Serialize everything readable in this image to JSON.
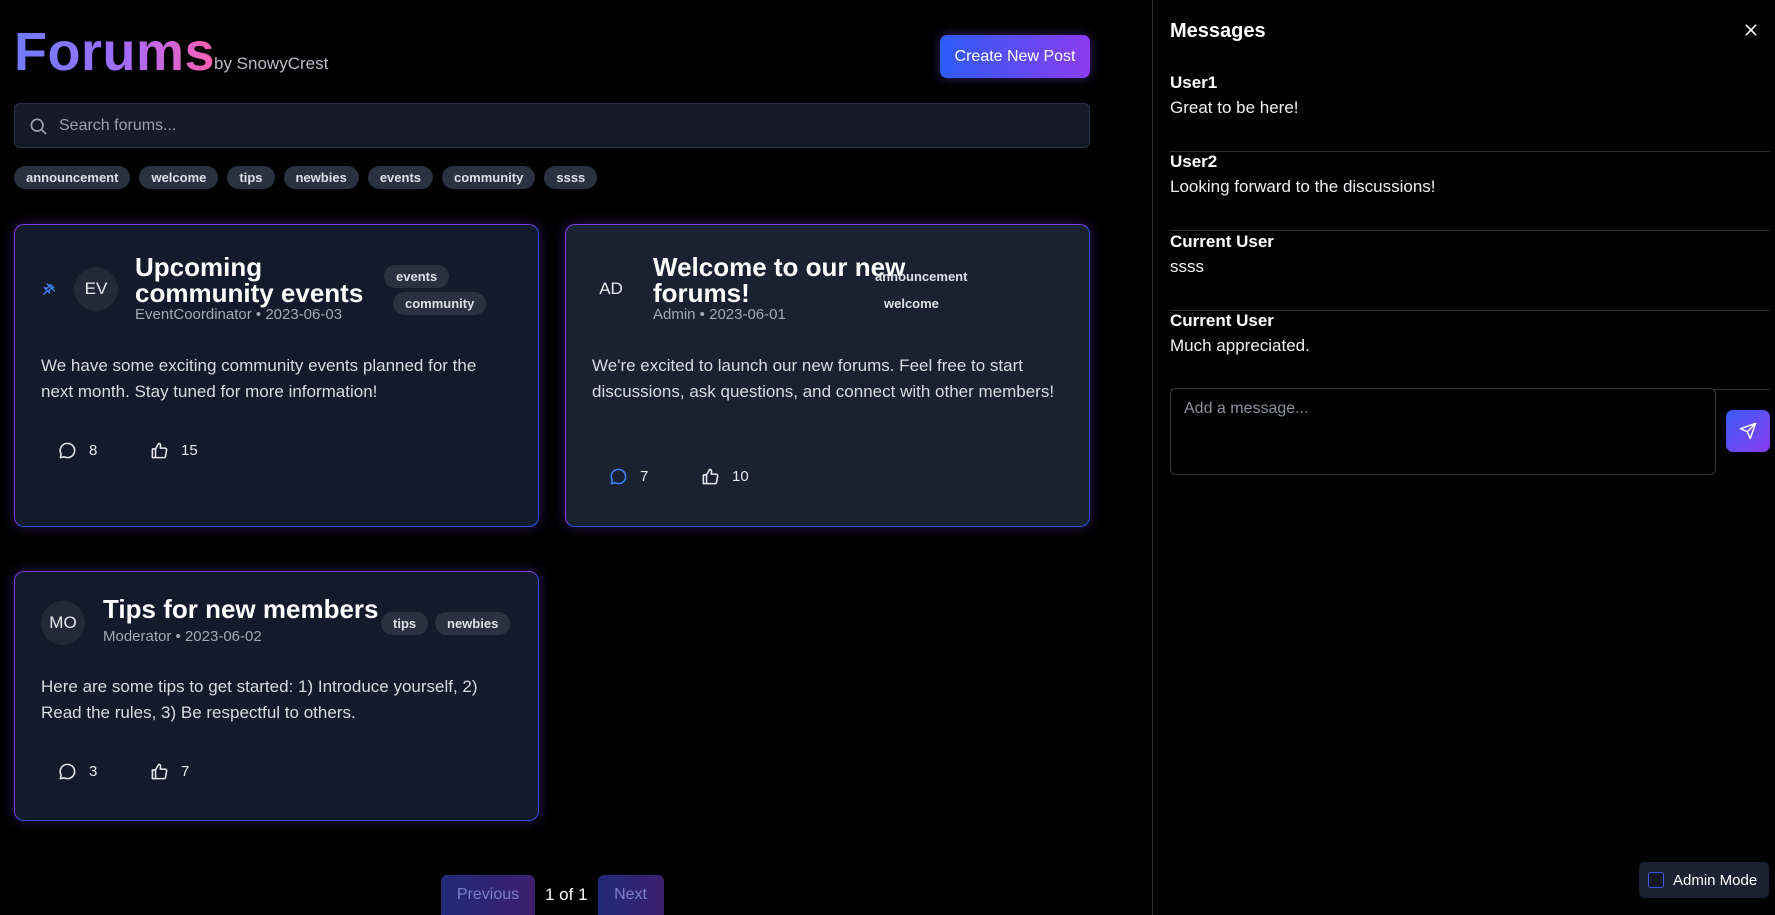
{
  "header": {
    "logo": "Forums",
    "byline": "by SnowyCrest",
    "create_button": "Create New Post"
  },
  "search": {
    "placeholder": "Search forums..."
  },
  "tags": [
    "announcement",
    "welcome",
    "tips",
    "newbies",
    "events",
    "community",
    "ssss"
  ],
  "posts": [
    {
      "pinned": true,
      "avatar": "EV",
      "title_line1": "Upcoming",
      "title_line2": "community events",
      "meta": "EventCoordinator • 2023-06-03",
      "tags": [
        "events",
        "community"
      ],
      "body": "We have some exciting community events planned for the next month. Stay tuned for more information!",
      "comments": "8",
      "likes": "15"
    },
    {
      "pinned": false,
      "avatar": "AD",
      "title_line1": "Welcome to our new",
      "title_line2": "forums!",
      "meta": "Admin • 2023-06-01",
      "tags": [
        "announcement",
        "welcome"
      ],
      "body": "We're excited to launch our new forums. Feel free to start discussions, ask questions, and connect with other members!",
      "comments": "7",
      "likes": "10"
    },
    {
      "pinned": false,
      "avatar": "MO",
      "title_line1": "Tips for new members",
      "meta": "Moderator • 2023-06-02",
      "tags": [
        "tips",
        "newbies"
      ],
      "body": "Here are some tips to get started: 1) Introduce yourself, 2) Read the rules, 3) Be respectful to others.",
      "comments": "3",
      "likes": "7"
    }
  ],
  "pagination": {
    "previous": "Previous",
    "info": "1 of 1",
    "next": "Next"
  },
  "sidebar": {
    "title": "Messages",
    "messages": [
      {
        "author": "User1",
        "text": "Great to be here!"
      },
      {
        "author": "User2",
        "text": "Looking forward to the discussions!"
      },
      {
        "author": "Current User",
        "text": "ssss"
      },
      {
        "author": "Current User",
        "text": "Much appreciated."
      }
    ],
    "composer_placeholder": "Add a message..."
  },
  "admin_mode": {
    "label": "Admin Mode",
    "checked": false
  },
  "colors": {
    "accent_blue": "#2d5cf6",
    "accent_purple": "#8a3cf0",
    "background": "#000000",
    "card": "#121a2b"
  },
  "icons": [
    "search-icon",
    "pin-icon",
    "comment-icon",
    "thumbs-up-icon",
    "close-icon",
    "send-icon"
  ]
}
